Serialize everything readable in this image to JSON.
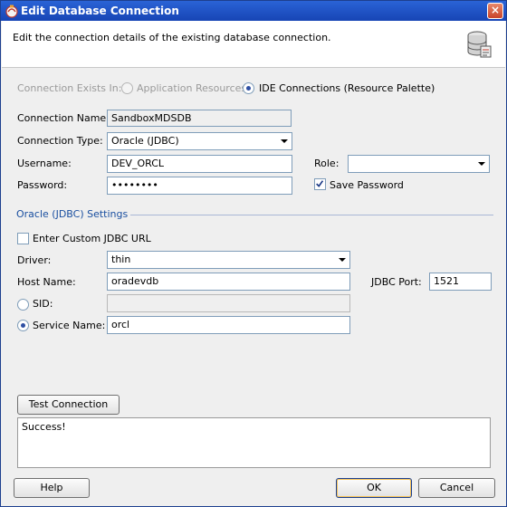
{
  "window": {
    "title": "Edit Database Connection",
    "close_glyph": "×"
  },
  "header": {
    "description": "Edit the connection details of the existing database connection."
  },
  "exists_in": {
    "label": "Connection Exists In:",
    "option_app": "Application Resources",
    "option_ide": "IDE Connections (Resource Palette)",
    "selected": "ide"
  },
  "form": {
    "connection_name_label": "Connection Name:",
    "connection_name": "SandboxMDSDB",
    "connection_type_label": "Connection Type:",
    "connection_type": "Oracle (JDBC)",
    "username_label": "Username:",
    "username": "DEV_ORCL",
    "role_label": "Role:",
    "role": "",
    "password_label": "Password:",
    "password": "••••••••",
    "save_password_label": "Save Password",
    "save_password": true
  },
  "oracle_settings": {
    "title": "Oracle (JDBC) Settings",
    "custom_url_label": "Enter Custom JDBC URL",
    "custom_url_checked": false,
    "driver_label": "Driver:",
    "driver": "thin",
    "host_label": "Host Name:",
    "host": "oradevdb",
    "port_label": "JDBC Port:",
    "port": "1521",
    "sid_label": "SID:",
    "sid": "",
    "service_name_label": "Service Name:",
    "service_name": "orcl",
    "selected": "service"
  },
  "test": {
    "button_label": "Test Connection",
    "status": "Success!"
  },
  "footer": {
    "help_label": "Help",
    "ok_label": "OK",
    "cancel_label": "Cancel"
  }
}
